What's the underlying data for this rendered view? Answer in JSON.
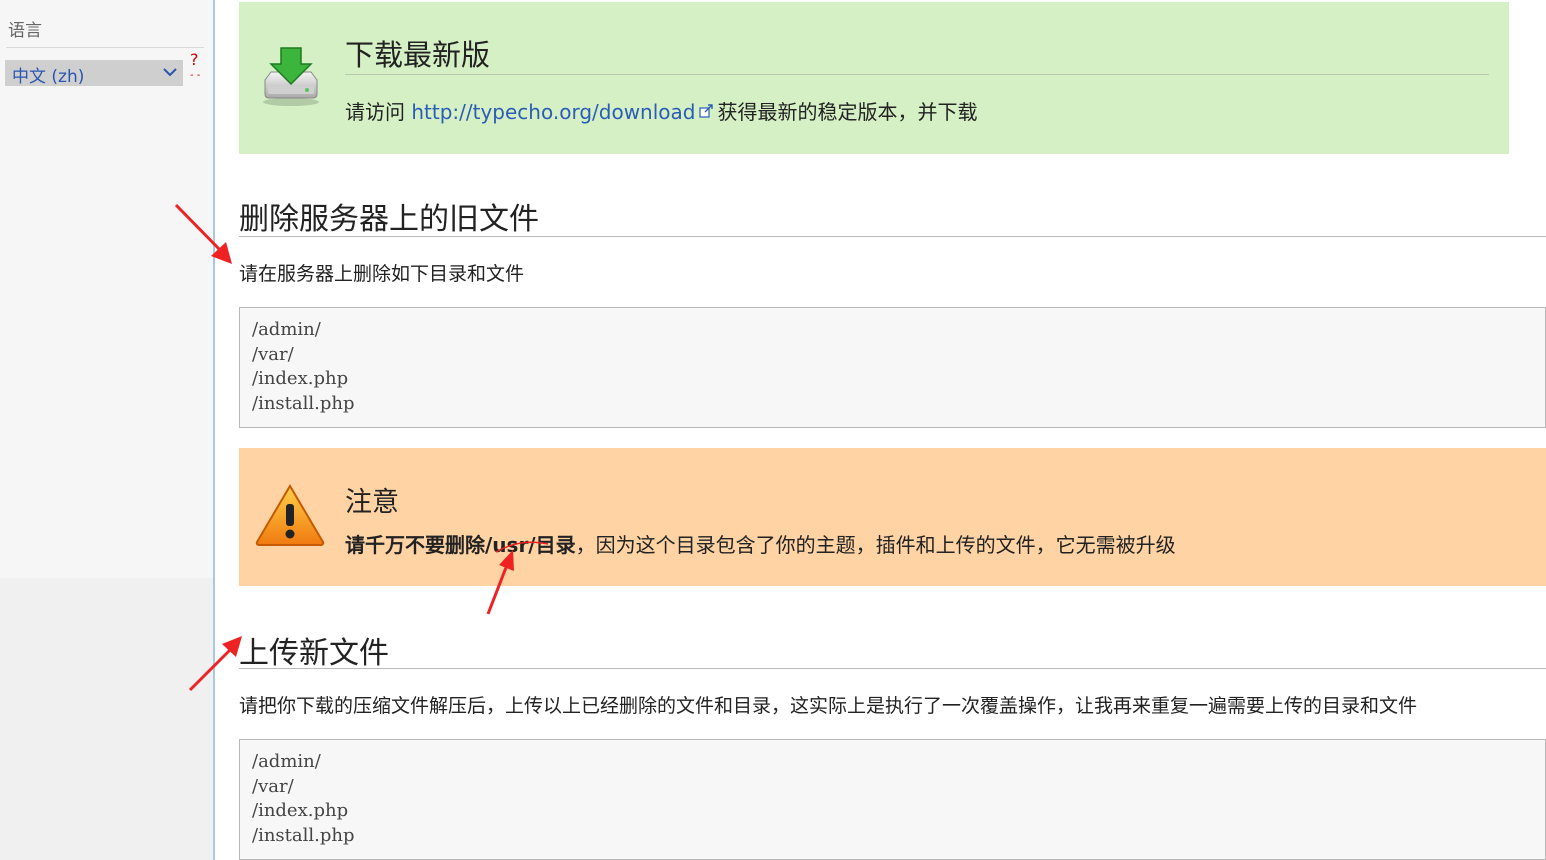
{
  "sidebar": {
    "language_title": "语言",
    "language_selected": "中文 (zh)",
    "help_mark": "?"
  },
  "download": {
    "title": "下载最新版",
    "text_before": "请访问 ",
    "link": "http://typecho.org/download",
    "text_after": "获得最新的稳定版本，并下载"
  },
  "delete_section": {
    "title": "删除服务器上的旧文件",
    "description": "请在服务器上删除如下目录和文件",
    "files": [
      "/admin/",
      "/var/",
      "/index.php",
      "/install.php"
    ]
  },
  "notice": {
    "title": "注意",
    "bold_text": "请千万不要删除/usr/目录",
    "rest_text": "，因为这个目录包含了你的主题，插件和上传的文件，它无需被升级"
  },
  "upload_section": {
    "title": "上传新文件",
    "description": "请把你下载的压缩文件解压后，上传以上已经删除的文件和目录，这实际上是执行了一次覆盖操作，让我再来重复一遍需要上传的目录和文件",
    "files": [
      "/admin/",
      "/var/",
      "/index.php",
      "/install.php"
    ]
  },
  "colors": {
    "download_bg": "#d5f0c5",
    "notice_bg": "#ffd3a4",
    "link": "#2b5db7",
    "annotation_arrow": "#ee2222"
  }
}
